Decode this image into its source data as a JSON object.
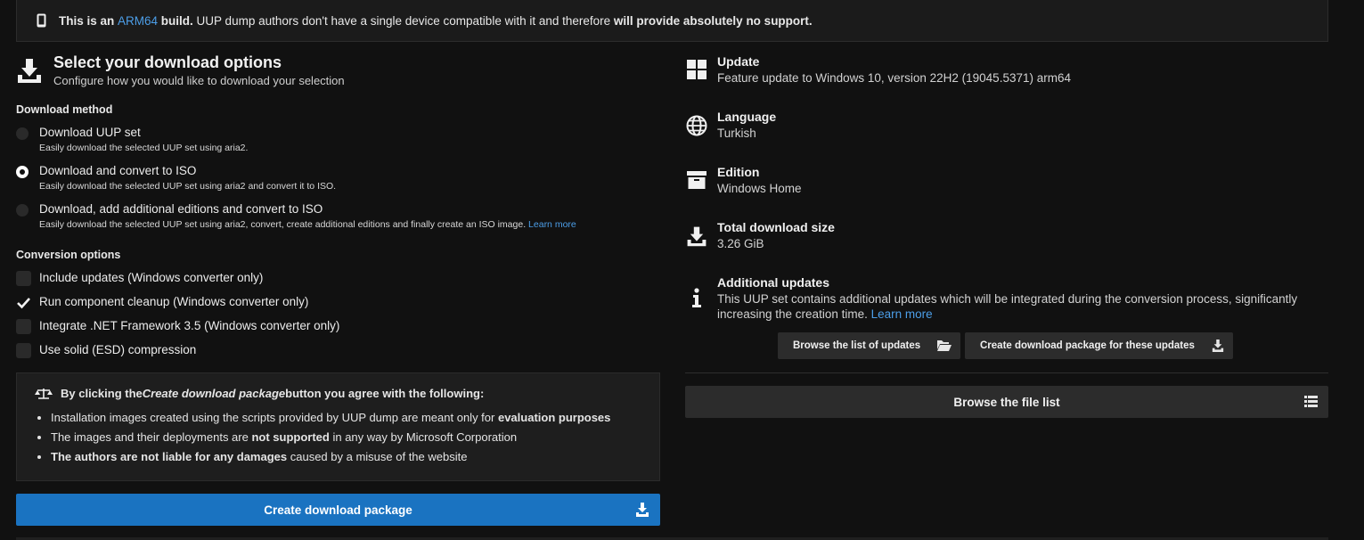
{
  "banner": {
    "icon": "phone-icon",
    "prefix": "This is an ",
    "arch": "ARM64",
    "build": " build.",
    "text": " UUP dump authors don't have a single device compatible with it and therefore ",
    "bold_end": "will provide absolutely no support."
  },
  "options": {
    "title": "Select your download options",
    "subtitle": "Configure how you would like to download your selection",
    "method_label": "Download method",
    "methods": [
      {
        "label": "Download UUP set",
        "desc": "Easily download the selected UUP set using aria2.",
        "selected": false
      },
      {
        "label": "Download and convert to ISO",
        "desc": "Easily download the selected UUP set using aria2 and convert it to ISO.",
        "selected": true
      },
      {
        "label": "Download, add additional editions and convert to ISO",
        "desc": "Easily download the selected UUP set using aria2, convert, create additional editions and finally create an ISO image.",
        "learn_more": "Learn more",
        "selected": false
      }
    ],
    "conversion_label": "Conversion options",
    "conversions": [
      {
        "label": "Include updates (Windows converter only)",
        "checked": false
      },
      {
        "label": "Run component cleanup (Windows converter only)",
        "checked": true
      },
      {
        "label": "Integrate .NET Framework 3.5 (Windows converter only)",
        "checked": false
      },
      {
        "label": "Use solid (ESD) compression",
        "checked": false
      }
    ]
  },
  "notice": {
    "head_prefix": "By clicking the ",
    "head_em": "Create download package",
    "head_suffix": " button you agree with the following:",
    "items": [
      {
        "text": "Installation images created using the scripts provided by UUP dump are meant only for ",
        "bold": "evaluation purposes",
        "after": ""
      },
      {
        "text": "The images and their deployments are ",
        "bold": "not supported",
        "after": " in any way by Microsoft Corporation"
      },
      {
        "text": "",
        "bold": "The authors are not liable for any damages",
        "after": " caused by a misuse of the website"
      }
    ]
  },
  "create_button": "Create download package",
  "info": {
    "update_title": "Update",
    "update_value": "Feature update to Windows 10, version 22H2 (19045.5371) arm64",
    "language_title": "Language",
    "language_value": "Turkish",
    "edition_title": "Edition",
    "edition_value": "Windows Home",
    "size_title": "Total download size",
    "size_value": "3.26 GiB",
    "additional_title": "Additional updates",
    "additional_value": "This UUP set contains additional updates which will be integrated during the conversion process, significantly increasing the creation time.",
    "additional_link": "Learn more"
  },
  "buttons": {
    "browse_updates": "Browse the list of updates",
    "create_updates_package": "Create download package for these updates",
    "browse_files": "Browse the file list"
  },
  "colors": {
    "accent": "#1a73c1",
    "link": "#4c9ee8",
    "background": "#111111"
  }
}
